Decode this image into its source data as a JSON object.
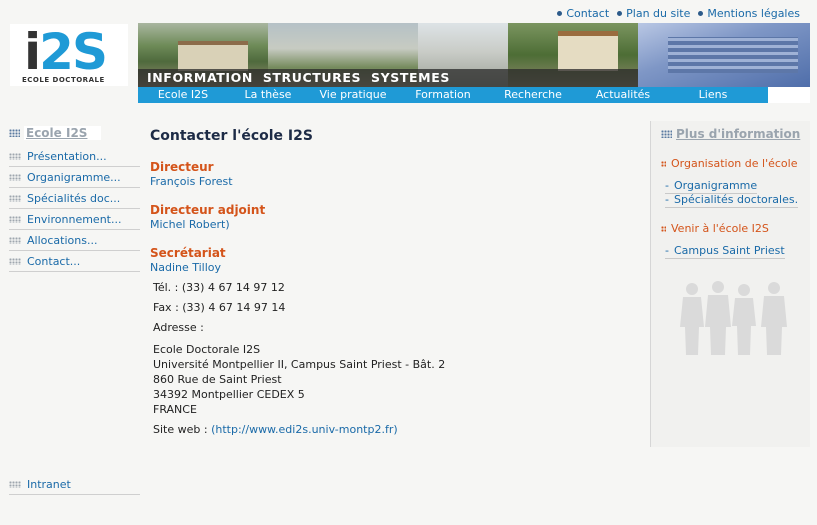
{
  "top_links": [
    {
      "label": "Contact"
    },
    {
      "label": "Plan du site"
    },
    {
      "label": "Mentions légales"
    }
  ],
  "logo": {
    "mark_i": "i",
    "mark_2": "2",
    "mark_s": "S",
    "subtitle": "ECOLE DOCTORALE"
  },
  "banner": {
    "tagline": "INFORMATION  STRUCTURES  SYSTEMES"
  },
  "menu": [
    {
      "label": "Ecole I2S"
    },
    {
      "label": "La thèse"
    },
    {
      "label": "Vie pratique"
    },
    {
      "label": "Formation"
    },
    {
      "label": "Recherche"
    },
    {
      "label": "Actualités"
    },
    {
      "label": "Liens"
    }
  ],
  "sidebar": {
    "title": "Ecole I2S",
    "items": [
      {
        "label": "Présentation..."
      },
      {
        "label": "Organigramme..."
      },
      {
        "label": "Spécialités doc..."
      },
      {
        "label": "Environnement..."
      },
      {
        "label": "Allocations..."
      },
      {
        "label": "Contact..."
      }
    ],
    "intranet": "Intranet"
  },
  "main": {
    "title": "Contacter l'école I2S",
    "directeur": {
      "title": "Directeur",
      "name": "François Forest"
    },
    "adjoint": {
      "title": "Directeur adjoint",
      "name": "Michel Robert)"
    },
    "secretariat": {
      "title": "Secrétariat",
      "name": "Nadine Tilloy"
    },
    "tel": "Tél. : (33) 4 67 14 97 12",
    "fax": "Fax : (33) 4 67 14 97 14",
    "adresse_label": "Adresse :",
    "adresse": [
      "Ecole Doctorale I2S",
      "Université Montpellier II, Campus Saint Priest - Bât. 2",
      "860 Rue de Saint Priest",
      "34392 Montpellier CEDEX 5",
      "FRANCE"
    ],
    "site_label": "Site web :",
    "site_url": "(http://www.edi2s.univ-montp2.fr)"
  },
  "right": {
    "title": "Plus d'information",
    "group1": "Organisation de l'école",
    "group1_links": [
      "Organigramme",
      "Spécialités doctorales."
    ],
    "group2": "Venir à l'école I2S",
    "group2_links": [
      "Campus Saint Priest"
    ],
    "dash": "-"
  },
  "colors": {
    "accent": "#1f9ad6",
    "link": "#1a6aa8",
    "heading": "#d4541a",
    "title": "#1d2b46"
  }
}
